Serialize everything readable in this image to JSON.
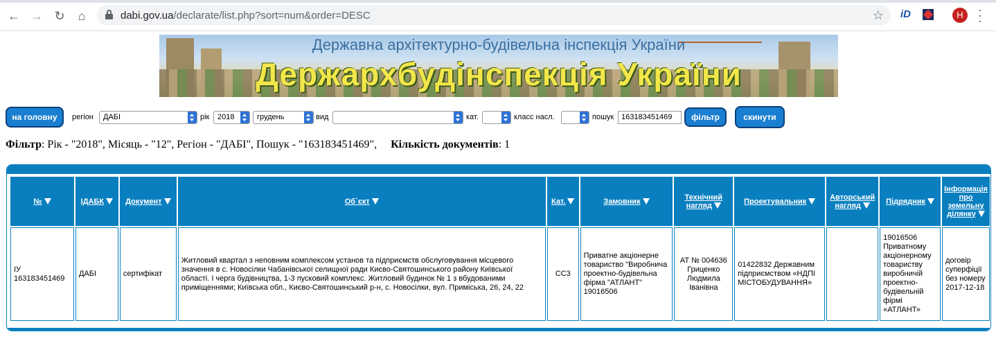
{
  "browser": {
    "url_host": "dabi.gov.ua",
    "url_path": "/declarate/list.php?sort=num&order=DESC",
    "avatar_letter": "Н",
    "back_icon": "arrow-left-icon",
    "forward_icon": "arrow-right-icon",
    "reload_icon": "reload-icon",
    "home_icon": "home-icon",
    "ext1_label": "iD"
  },
  "banner": {
    "subtitle": "Державна архітектурно-будівельна інспекція України",
    "title": "Держархбудінспекція України"
  },
  "filters": {
    "home_button": "на головну",
    "region_label": "регіон",
    "region_value": "ДАБІ",
    "year_label": "рік",
    "year_value": "2018",
    "month_value": "грудень",
    "type_label": "вид",
    "type_value": "",
    "category_label": "кат.",
    "category_value": "",
    "class_label": "класс насл.",
    "class_value": "",
    "search_label": "пошук",
    "search_value": "163183451469",
    "filter_button": "фільтр",
    "reset_button": "скинути"
  },
  "summary": {
    "filter_label": "Фільтр",
    "filter_text": ": Рік - \"2018\", Місяць - \"12\", Регіон - \"ДАБІ\", Пошук - \"163183451469\",",
    "count_label": "Кількість документів",
    "count_value": ": 1"
  },
  "table": {
    "headers": [
      "№",
      "ІДАБК",
      "Документ",
      "Об`єкт",
      "Кат.",
      "Замовник",
      "Технічний нагляд",
      "Проектувальник",
      "Авторський нагляд",
      "Підрядник",
      "Інформація про земельну ділянку"
    ],
    "rows": [
      {
        "num": "ІУ 163183451469",
        "idabk": "ДАБІ",
        "document": "сертифікат",
        "object": "Житловий квартал з неповним комплексом установ та підприємств обслуговування місцевого значення в с. Новосілки Чабанівської селищної ради Києво-Святошинського району Київської області. І черга будівництва, 1-3 пусковий комплекс. Житловий будинок № 1 з вбудованими приміщеннями; Київська обл., Києво-Святошинський р-н, с. Новосілки, вул. Приміська, 26, 24, 22",
        "category": "СС3",
        "customer": "Приватне акціонерне товариство \"Виробнича проектно-будівельна фірма \"АТЛАНТ\" 19016506",
        "tech_supervision": "АТ № 004636 Гриценко Людмила Іванівна",
        "designer": "01422832 Державним підприємством «НДПІ МІСТОБУДУВАННЯ»",
        "author_supervision": "",
        "contractor": "19016506 Приватному акціонерному товариству виробничій проектно-будівельній фірмі «АТЛАНТ»",
        "land_info": "договір суперфіції без номеру 2017-12-18"
      }
    ]
  }
}
